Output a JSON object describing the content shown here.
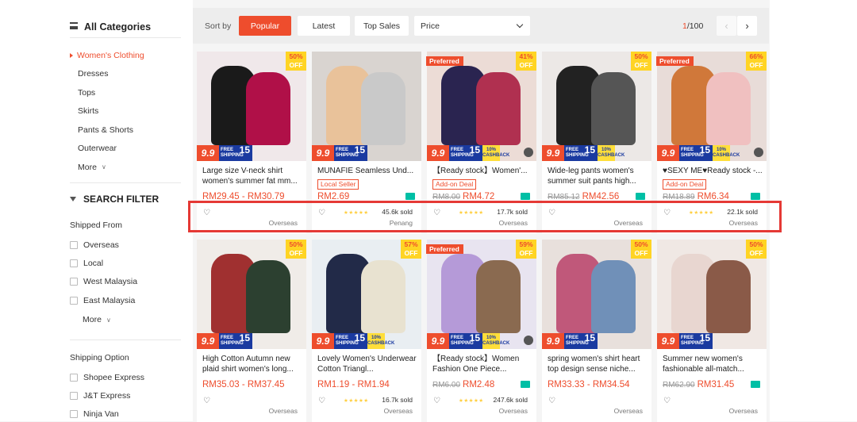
{
  "sidebar": {
    "categories_title": "All Categories",
    "categories": [
      "Women's Clothing",
      "Dresses",
      "Tops",
      "Skirts",
      "Pants & Shorts",
      "Outerwear"
    ],
    "more": "More",
    "filter_title": "SEARCH FILTER",
    "shipped_from": {
      "title": "Shipped From",
      "options": [
        "Overseas",
        "Local",
        "West Malaysia",
        "East Malaysia"
      ],
      "more": "More"
    },
    "shipping_option": {
      "title": "Shipping Option",
      "options": [
        "Shopee Express",
        "J&T Express",
        "Ninja Van"
      ]
    }
  },
  "sortbar": {
    "label": "Sort by",
    "buttons": [
      "Popular",
      "Latest",
      "Top Sales"
    ],
    "price": "Price",
    "page_current": "1",
    "page_total": "/100"
  },
  "badge": {
    "preferred": "Preferred",
    "off": "OFF",
    "sale": "9.9",
    "free_line1": "FREE",
    "free_line2": "SHIPPING",
    "free_num": "15",
    "cashback_pct": "10%",
    "cashback": "CASHBACK"
  },
  "products": [
    {
      "title": "Large size V-neck shirt women's summer fat mm...",
      "price": "RM29.45 - RM30.79",
      "discount": "50%",
      "preferred": false,
      "tag": "",
      "old": "",
      "sold": "",
      "location": "Overseas",
      "cashback": false
    },
    {
      "title": "MUNAFIE Seamless Und...",
      "price": "RM2.69",
      "discount": "",
      "preferred": false,
      "tag": "Local Seller",
      "old": "",
      "sold": "45.6k sold",
      "location": "Penang",
      "cashback": false
    },
    {
      "title": "【Ready stock】Women'...",
      "price": "RM4.72",
      "discount": "41%",
      "preferred": true,
      "tag": "Add-on Deal",
      "old": "RM8.00",
      "sold": "17.7k sold",
      "location": "Overseas",
      "cashback": true
    },
    {
      "title": "Wide-leg pants women's summer suit pants high...",
      "price": "RM42.56",
      "discount": "50%",
      "preferred": false,
      "tag": "",
      "old": "RM85.12",
      "sold": "",
      "location": "Overseas",
      "cashback": true
    },
    {
      "title": "♥SEXY ME♥Ready stock -...",
      "price": "RM6.34",
      "discount": "66%",
      "preferred": true,
      "tag": "Add-on Deal",
      "old": "RM18.89",
      "sold": "22.1k sold",
      "location": "Overseas",
      "cashback": true
    },
    {
      "title": "High Cotton Autumn new plaid shirt women's long...",
      "price": "RM35.03 - RM37.45",
      "discount": "50%",
      "preferred": false,
      "tag": "",
      "old": "",
      "sold": "",
      "location": "Overseas",
      "cashback": false
    },
    {
      "title": "Lovely Women's Underwear Cotton Triangl...",
      "price": "RM1.19 - RM1.94",
      "discount": "57%",
      "preferred": false,
      "tag": "",
      "old": "",
      "sold": "16.7k sold",
      "location": "Overseas",
      "cashback": true
    },
    {
      "title": "【Ready stock】Women Fashion One Piece...",
      "price": "RM2.48",
      "discount": "59%",
      "preferred": true,
      "tag": "",
      "old": "RM6.00",
      "sold": "247.6k sold",
      "location": "Overseas",
      "cashback": true
    },
    {
      "title": "spring women's shirt heart top design sense niche...",
      "price": "RM33.33 - RM34.54",
      "discount": "50%",
      "preferred": false,
      "tag": "",
      "old": "",
      "sold": "",
      "location": "Overseas",
      "cashback": false
    },
    {
      "title": "Summer new women's fashionable all-match...",
      "price": "RM31.45",
      "discount": "50%",
      "preferred": false,
      "tag": "",
      "old": "RM62.90",
      "sold": "",
      "location": "Overseas",
      "cashback": false
    }
  ],
  "colors": {
    "accent": "#ee4d2d",
    "highlight": "#e53935",
    "sticker_blue": "#1a3aa0",
    "discount_yellow": "#ffd424"
  }
}
